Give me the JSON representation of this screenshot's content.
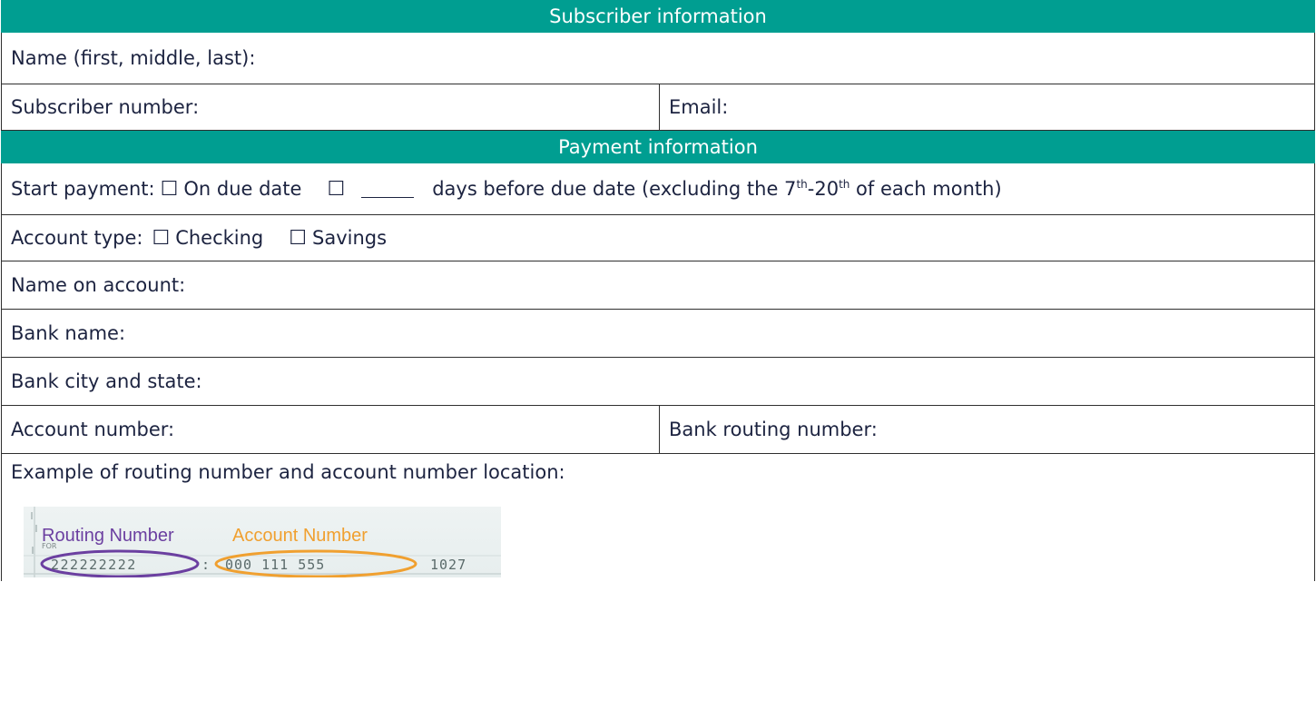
{
  "subscriber": {
    "header": "Subscriber information",
    "name_label": "Name (first, middle, last):",
    "number_label": "Subscriber number:",
    "email_label": "Email:"
  },
  "payment": {
    "header": "Payment information",
    "start_label": "Start payment:",
    "on_due_date": "On due date",
    "days_before_prefix": "days before due date (excluding the 7",
    "th1": "th",
    "dash": "-20",
    "th2": "th",
    "days_before_suffix": " of each month)",
    "account_type_label": "Account type:",
    "checking": "Checking",
    "savings": "Savings",
    "name_on_account_label": "Name on account:",
    "bank_name_label": "Bank name:",
    "bank_city_label": "Bank city and state:",
    "account_number_label": "Account number:",
    "routing_number_label": "Bank routing number:",
    "example_label": "Example of routing number and account number location:",
    "checkbox_glyph": "☐"
  },
  "check_example": {
    "routing_title": "Routing Number",
    "account_title": "Account Number",
    "for_label": "FOR",
    "routing_digits": "222222222",
    "account_digits": "000 111 555",
    "check_number": "1027",
    "routing_color": "#6b3fa0",
    "account_color": "#f0a030"
  }
}
